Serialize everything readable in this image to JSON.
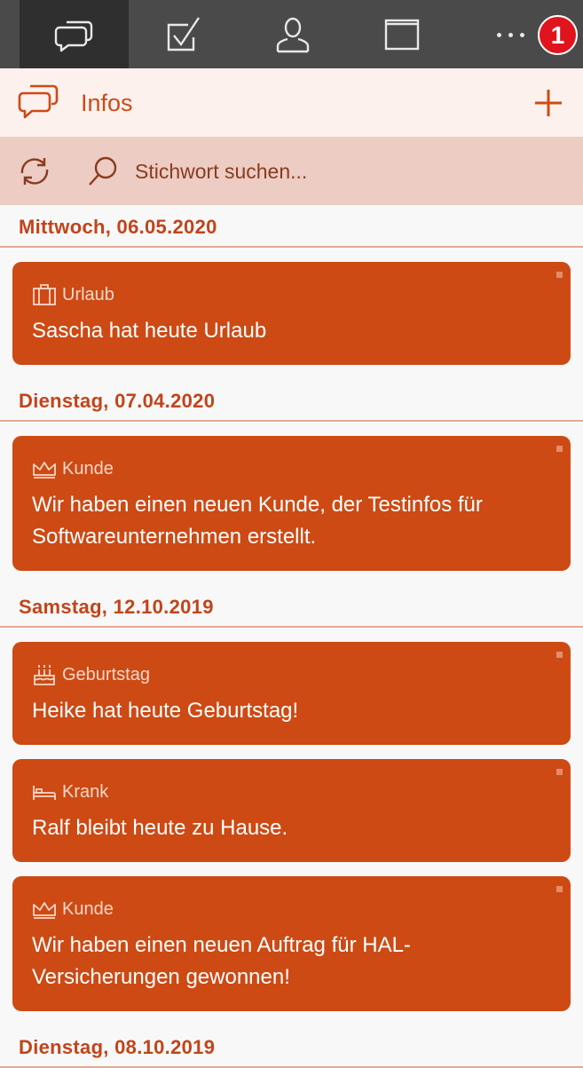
{
  "app": {
    "badge_count": "1",
    "accent": "#cd4a14",
    "tabs": [
      {
        "icon": "chat-icon",
        "active": true
      },
      {
        "icon": "checkbox-icon",
        "active": false
      },
      {
        "icon": "person-icon",
        "active": false
      },
      {
        "icon": "window-icon",
        "active": false
      }
    ]
  },
  "header": {
    "title": "Infos"
  },
  "search": {
    "placeholder": "Stichwort suchen..."
  },
  "groups": [
    {
      "date": "Mittwoch, 06.05.2020",
      "items": [
        {
          "category": "Urlaub",
          "icon": "suitcase-icon",
          "text": "Sascha hat heute Urlaub"
        }
      ]
    },
    {
      "date": "Dienstag, 07.04.2020",
      "items": [
        {
          "category": "Kunde",
          "icon": "crown-icon",
          "text": "Wir haben einen neuen Kunde, der Testinfos für Softwareunternehmen erstellt."
        }
      ]
    },
    {
      "date": "Samstag, 12.10.2019",
      "items": [
        {
          "category": "Geburtstag",
          "icon": "cake-icon",
          "text": "Heike hat heute Geburtstag!"
        },
        {
          "category": "Krank",
          "icon": "bed-icon",
          "text": "Ralf bleibt heute zu Hause."
        },
        {
          "category": "Kunde",
          "icon": "crown-icon",
          "text": "Wir haben einen neuen Auftrag für HAL-Versicherungen gewonnen!"
        }
      ]
    },
    {
      "date": "Dienstag, 08.10.2019",
      "items": []
    }
  ]
}
